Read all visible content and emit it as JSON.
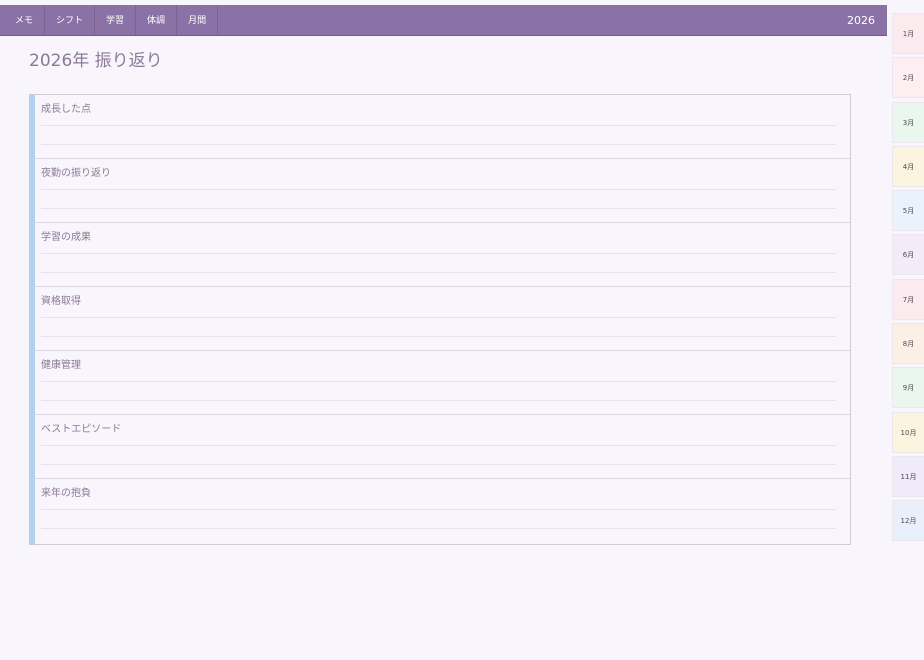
{
  "nav": {
    "tabs": [
      {
        "label": "メモ"
      },
      {
        "label": "シフト"
      },
      {
        "label": "学習"
      },
      {
        "label": "体調"
      },
      {
        "label": "月間"
      }
    ],
    "year": "2026"
  },
  "page": {
    "title": "2026年 振り返り"
  },
  "sections": [
    {
      "label": "成長した点"
    },
    {
      "label": "夜勤の振り返り"
    },
    {
      "label": "学習の成果"
    },
    {
      "label": "資格取得"
    },
    {
      "label": "健康管理"
    },
    {
      "label": "ベストエピソード"
    },
    {
      "label": "来年の抱負"
    }
  ],
  "months": [
    {
      "label": "1月",
      "color": "#fcebee"
    },
    {
      "label": "2月",
      "color": "#fceef1"
    },
    {
      "label": "3月",
      "color": "#eaf7ee"
    },
    {
      "label": "4月",
      "color": "#fbf4df"
    },
    {
      "label": "5月",
      "color": "#eaf3fb"
    },
    {
      "label": "6月",
      "color": "#f3ecf8"
    },
    {
      "label": "7月",
      "color": "#fcebee"
    },
    {
      "label": "8月",
      "color": "#fcefe6"
    },
    {
      "label": "9月",
      "color": "#eaf7ee"
    },
    {
      "label": "10月",
      "color": "#fbf4df"
    },
    {
      "label": "11月",
      "color": "#f0ebf8"
    },
    {
      "label": "12月",
      "color": "#e9f0fb"
    }
  ]
}
